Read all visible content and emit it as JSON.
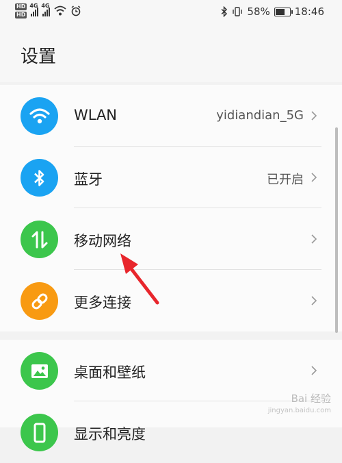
{
  "status_bar": {
    "hd_labels": [
      "HD",
      "HD"
    ],
    "network_labels": [
      "4G",
      "4G"
    ],
    "battery_percent": "58%",
    "battery_level": 0.58,
    "time": "18:46",
    "icons": [
      "signal-icon",
      "wifi-icon",
      "alarm-icon",
      "bluetooth-icon",
      "vibrate-icon",
      "battery-icon"
    ]
  },
  "header": {
    "title": "设置"
  },
  "settings": {
    "group1": [
      {
        "label": "WLAN",
        "value": "yidiandian_5G",
        "icon": "wifi-icon",
        "color": "#1aa3f2"
      },
      {
        "label": "蓝牙",
        "value": "已开启",
        "icon": "bluetooth-icon",
        "color": "#1aa3f2"
      },
      {
        "label": "移动网络",
        "value": "",
        "icon": "mobile-data-icon",
        "color": "#3cc64c"
      },
      {
        "label": "更多连接",
        "value": "",
        "icon": "link-icon",
        "color": "#f89a12"
      }
    ],
    "group2": [
      {
        "label": "桌面和壁纸",
        "value": "",
        "icon": "image-icon",
        "color": "#3cc64c"
      },
      {
        "label": "显示和亮度",
        "value": "",
        "icon": "phone-icon",
        "color": "#3cc64c"
      }
    ]
  },
  "watermark": {
    "text": "Bai 经验",
    "sub": "jingyan.baidu.com"
  }
}
